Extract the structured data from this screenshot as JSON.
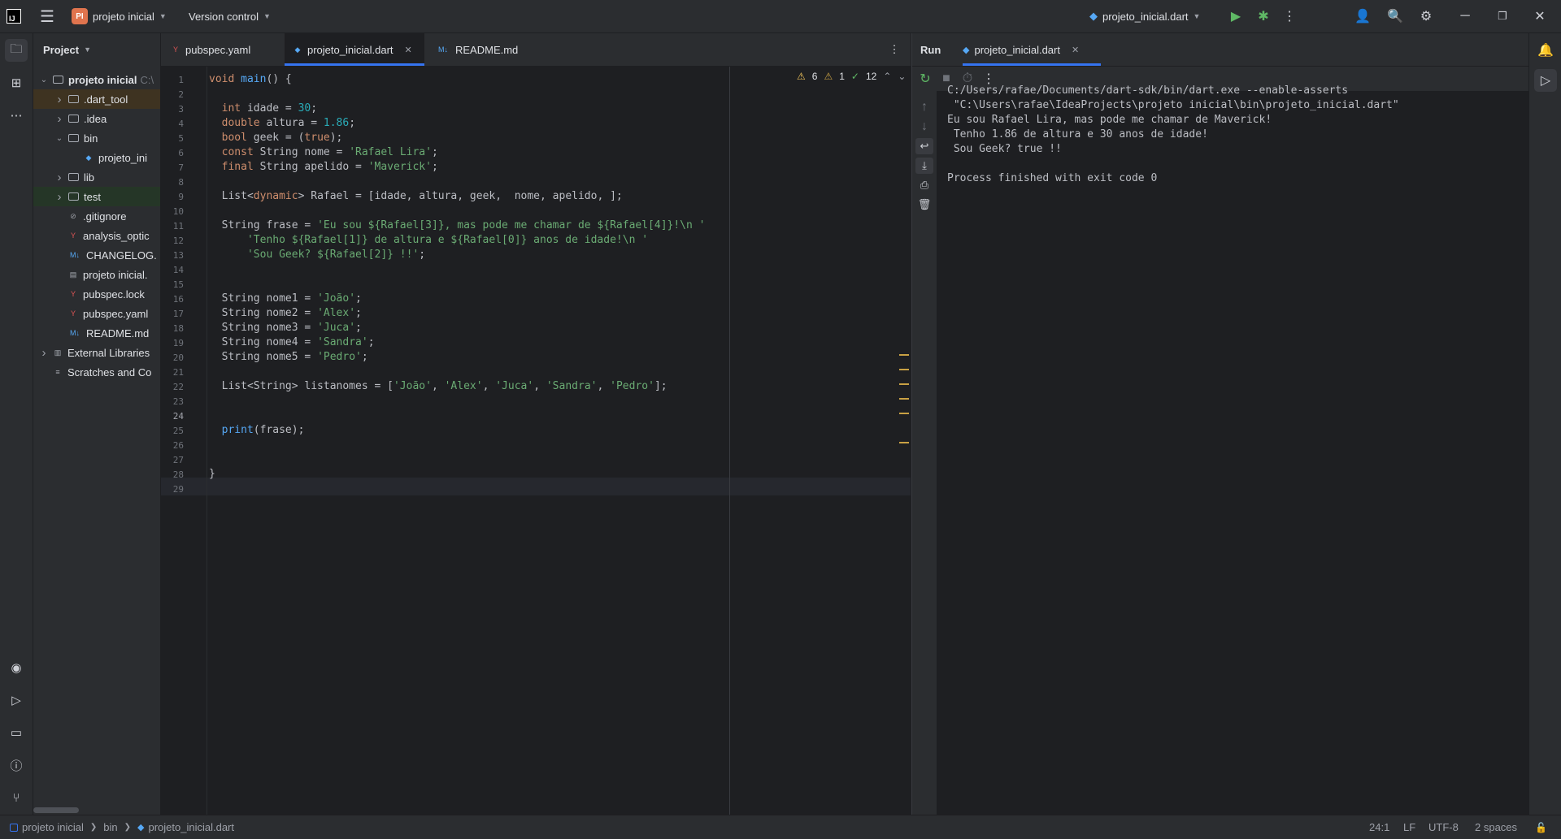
{
  "titlebar": {
    "project_badge": "PI",
    "project_name": "projeto inicial",
    "version_control": "Version control",
    "run_config": "projeto_inicial.dart"
  },
  "project_panel": {
    "title": "Project",
    "items": [
      {
        "label": "projeto inicial",
        "suffix": "C:\\",
        "level": 0,
        "expanded": true,
        "kind": "module",
        "bold": true
      },
      {
        "label": ".dart_tool",
        "level": 1,
        "expanded": false,
        "kind": "folder",
        "highlight": "orange"
      },
      {
        "label": ".idea",
        "level": 1,
        "expanded": false,
        "kind": "folder"
      },
      {
        "label": "bin",
        "level": 1,
        "expanded": true,
        "kind": "folder"
      },
      {
        "label": "projeto_ini",
        "level": 2,
        "kind": "dart"
      },
      {
        "label": "lib",
        "level": 1,
        "expanded": false,
        "kind": "folder"
      },
      {
        "label": "test",
        "level": 1,
        "expanded": false,
        "kind": "folder",
        "highlight": "green"
      },
      {
        "label": ".gitignore",
        "level": 1,
        "kind": "ignore"
      },
      {
        "label": "analysis_optic",
        "level": 1,
        "kind": "yaml"
      },
      {
        "label": "CHANGELOG.",
        "level": 1,
        "kind": "md"
      },
      {
        "label": "projeto inicial.",
        "level": 1,
        "kind": "file"
      },
      {
        "label": "pubspec.lock",
        "level": 1,
        "kind": "yaml"
      },
      {
        "label": "pubspec.yaml",
        "level": 1,
        "kind": "yaml"
      },
      {
        "label": "README.md",
        "level": 1,
        "kind": "md"
      },
      {
        "label": "External Libraries",
        "level": 0,
        "expanded": false,
        "kind": "lib"
      },
      {
        "label": "Scratches and Co",
        "level": 0,
        "kind": "scratch"
      }
    ]
  },
  "editor": {
    "tabs": [
      {
        "label": "pubspec.yaml",
        "icon": "yaml"
      },
      {
        "label": "projeto_inicial.dart",
        "icon": "dart",
        "active": true
      },
      {
        "label": "README.md",
        "icon": "md"
      }
    ],
    "inspections": {
      "warnings": "6",
      "weak_warnings": "1",
      "typos": "12"
    },
    "caret_line": 24,
    "lines": [
      "void main() {",
      "",
      "  int idade = 30;",
      "  double altura = 1.86;",
      "  bool geek = (true);",
      "  const String nome = 'Rafael Lira';",
      "  final String apelido = 'Maverick';",
      "",
      "  List<dynamic> Rafael = [idade, altura, geek,  nome, apelido, ];",
      "",
      "  String frase = 'Eu sou ${Rafael[3]}, mas pode me chamar de ${Rafael[4]}!\\n '",
      "      'Tenho ${Rafael[1]} de altura e ${Rafael[0]} anos de idade!\\n '",
      "      'Sou Geek? ${Rafael[2]} !!';",
      "",
      "",
      "  String nome1 = 'João';",
      "  String nome2 = 'Alex';",
      "  String nome3 = 'Juca';",
      "  String nome4 = 'Sandra';",
      "  String nome5 = 'Pedro';",
      "",
      "  List<String> listanomes = ['João', 'Alex', 'Juca', 'Sandra', 'Pedro'];",
      "",
      "",
      "  print(frase);",
      "",
      "",
      "}",
      ""
    ]
  },
  "run": {
    "title": "Run",
    "tab": "projeto_inicial.dart",
    "output": [
      "C:/Users/rafae/Documents/dart-sdk/bin/dart.exe --enable-asserts",
      " \"C:\\Users\\rafae\\IdeaProjects\\projeto inicial\\bin\\projeto_inicial.dart\"",
      "Eu sou Rafael Lira, mas pode me chamar de Maverick!",
      " Tenho 1.86 de altura e 30 anos de idade!",
      " Sou Geek? true !!",
      "",
      "Process finished with exit code 0"
    ]
  },
  "statusbar": {
    "breadcrumb": [
      "projeto inicial",
      "bin",
      "projeto_inicial.dart"
    ],
    "position": "24:1",
    "line_separator": "LF",
    "encoding": "UTF-8",
    "indent": "2 spaces"
  }
}
